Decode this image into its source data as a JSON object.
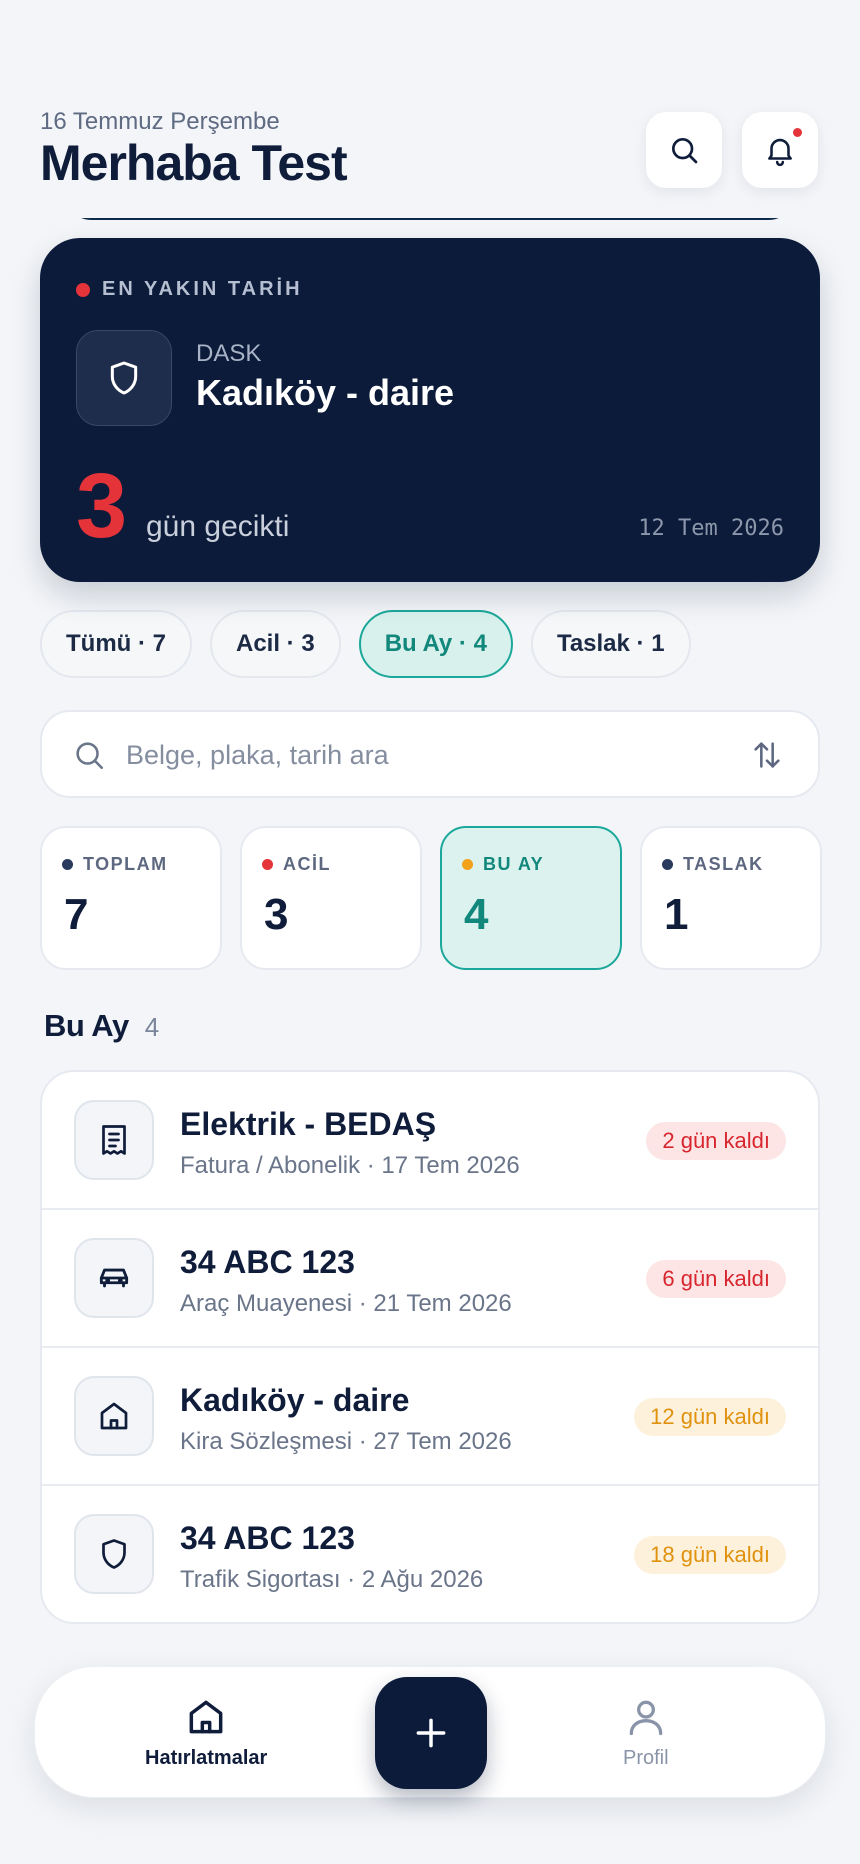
{
  "header": {
    "date": "16 Temmuz Perşembe",
    "greeting": "Merhaba Test",
    "icons": [
      "search-icon",
      "bell-icon"
    ]
  },
  "hero": {
    "tag": "EN YAKIN TARİH",
    "icon": "shield-icon",
    "type": "DASK",
    "title": "Kadıköy - daire",
    "days": "3",
    "days_text": "gün gecikti",
    "date": "12 Tem 2026",
    "accent": "#e5333a"
  },
  "filters": [
    {
      "label": "Tümü · 7"
    },
    {
      "label": "Acil · 3"
    },
    {
      "label": "Bu Ay · 4",
      "active": true
    },
    {
      "label": "Taslak · 1"
    }
  ],
  "search": {
    "placeholder": "Belge, plaka, tarih ara",
    "value": "",
    "icons": [
      "search-icon",
      "sort-icon"
    ]
  },
  "stats": [
    {
      "label": "TOPLAM",
      "value": "7",
      "dot": "#2a3a5c"
    },
    {
      "label": "ACİL",
      "value": "3",
      "dot": "#e5333a"
    },
    {
      "label": "BU AY",
      "value": "4",
      "dot": "#f2a11b",
      "active": true
    },
    {
      "label": "TASLAK",
      "value": "1",
      "dot": "#2a3a5c"
    }
  ],
  "section": {
    "title": "Bu Ay",
    "count": "4"
  },
  "items": [
    {
      "icon": "receipt-icon",
      "title": "Elektrik - BEDAŞ",
      "subtitle": "Fatura / Abonelik · 17 Tem 2026",
      "badge": "2 gün kaldı",
      "badge_tone": "red"
    },
    {
      "icon": "car-icon",
      "title": "34 ABC 123",
      "subtitle": "Araç Muayenesi · 21 Tem 2026",
      "badge": "6 gün kaldı",
      "badge_tone": "red"
    },
    {
      "icon": "home-icon",
      "title": "Kadıköy - daire",
      "subtitle": "Kira Sözleşmesi · 27 Tem 2026",
      "badge": "12 gün kaldı",
      "badge_tone": "amber"
    },
    {
      "icon": "shield-icon",
      "title": "34 ABC 123",
      "subtitle": "Trafik Sigortası · 2 Ağu 2026",
      "badge": "18 gün kaldı",
      "badge_tone": "amber"
    }
  ],
  "nav": {
    "home_label": "Hatırlatmalar",
    "profile_label": "Profil",
    "fab_icon": "plus-icon"
  },
  "colors": {
    "navy": "#0c1b3a",
    "teal": "#1ba89a",
    "red": "#e5333a",
    "amber": "#f2a11b"
  }
}
